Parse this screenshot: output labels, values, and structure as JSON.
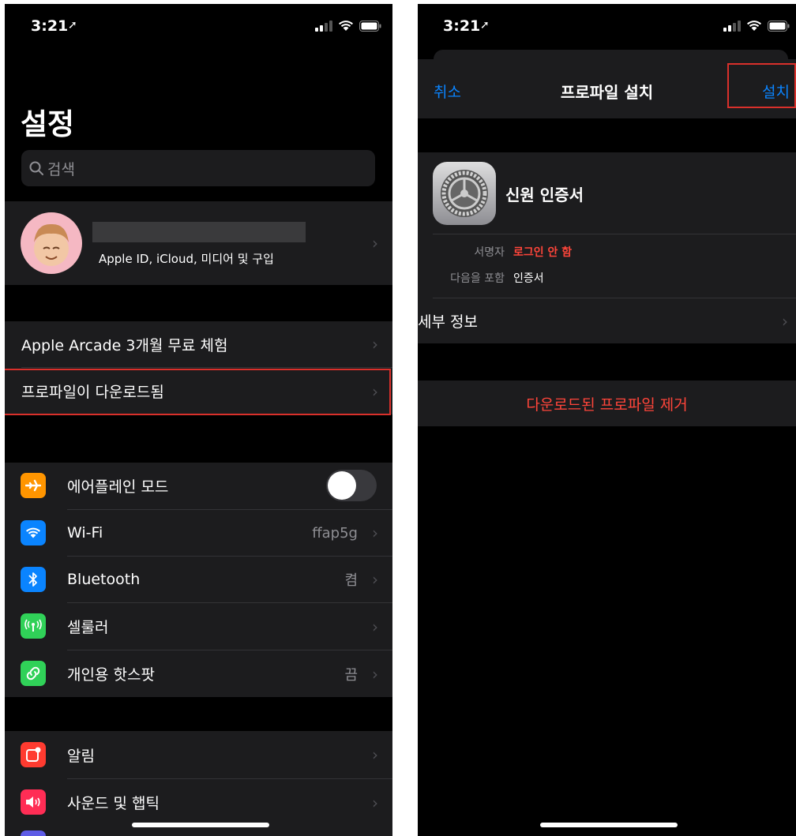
{
  "left": {
    "status": {
      "time": "3:21"
    },
    "title": "설정",
    "search": {
      "placeholder": "검색"
    },
    "account": {
      "subtitle": "Apple ID, iCloud, 미디어 및 구입"
    },
    "group1": [
      {
        "label": "Apple Arcade 3개월 무료 체험"
      },
      {
        "label": "프로파일이 다운로드됨"
      }
    ],
    "network": {
      "airplane": {
        "label": "에어플레인 모드",
        "icon": "airplane-icon",
        "color": "#ff9500",
        "toggle_on": false
      },
      "wifi": {
        "label": "Wi-Fi",
        "value": "ffap5g",
        "icon": "wifi-icon",
        "color": "#0a84ff"
      },
      "bluetooth": {
        "label": "Bluetooth",
        "value": "켬",
        "icon": "bluetooth-icon",
        "color": "#0a84ff"
      },
      "cellular": {
        "label": "셀룰러",
        "icon": "cellular-icon",
        "color": "#30d158"
      },
      "hotspot": {
        "label": "개인용 핫스팟",
        "value": "끔",
        "icon": "hotspot-icon",
        "color": "#30d158"
      }
    },
    "notifications": {
      "alerts": {
        "label": "알림",
        "icon": "notifications-icon",
        "color": "#ff3b30"
      },
      "sounds": {
        "label": "사운드 및 햅틱",
        "icon": "sound-icon",
        "color": "#ff2d55"
      }
    }
  },
  "right": {
    "status": {
      "time": "3:21"
    },
    "nav": {
      "cancel": "취소",
      "title": "프로파일 설치",
      "install": "설치"
    },
    "profile": {
      "name": "신원 인증서",
      "signed_by_key": "서명자",
      "signed_by_value": "로그인 안 함",
      "contains_key": "다음을 포함",
      "contains_value": "인증서"
    },
    "details": "세부 정보",
    "remove": "다운로드된 프로파일 제거"
  },
  "colors": {
    "accent": "#0a84ff",
    "destructive": "#ff453a",
    "highlight": "#d9302b"
  }
}
